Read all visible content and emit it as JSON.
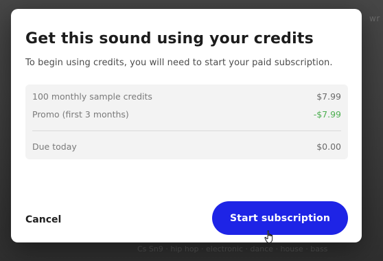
{
  "background": {
    "top_right_text": "wr",
    "bottom_strip_text": "Cs  Sn9  ·  hip hop  ·  electronic  ·  dance  ·  house  ·  bass"
  },
  "modal": {
    "title": "Get this sound using your credits",
    "subtitle": "To begin using credits, you will need to start your paid subscription.",
    "summary": {
      "rows": [
        {
          "label": "100 monthly sample credits",
          "amount": "$7.99"
        },
        {
          "label": "Promo (first 3 months)",
          "amount": "-$7.99"
        }
      ],
      "total": {
        "label": "Due today",
        "amount": "$0.00"
      }
    },
    "actions": {
      "cancel_label": "Cancel",
      "primary_label": "Start subscription"
    }
  },
  "colors": {
    "primary": "#1e24e6",
    "discount": "#4caf50",
    "summary_bg": "#f3f3f3"
  },
  "icons": {
    "cursor": "hand-pointer-icon"
  }
}
